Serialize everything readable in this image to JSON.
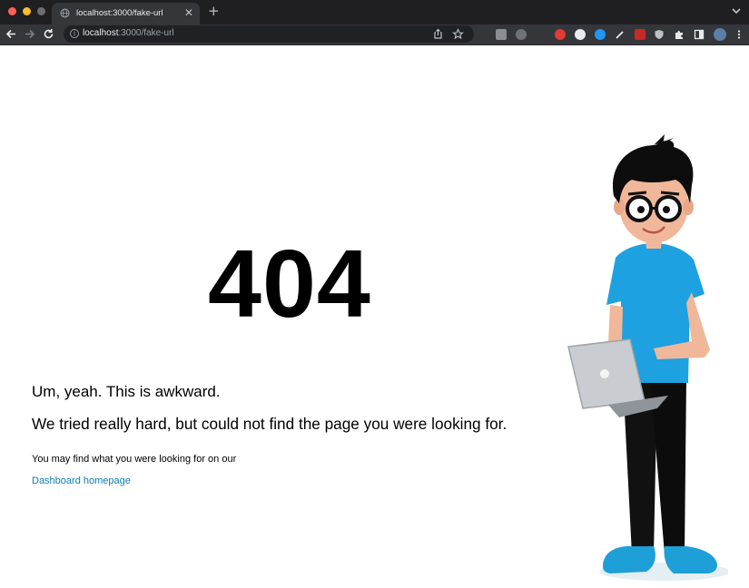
{
  "browser": {
    "tab": {
      "title": "localhost:3000/fake-url",
      "close": "✕"
    },
    "new_tab": "+",
    "url": {
      "host": "localhost",
      "path": ":3000/fake-url"
    }
  },
  "page": {
    "heading": "404",
    "line1": "Um, yeah. This is awkward.",
    "line2": "We tried really hard, but could not find the page you were looking for.",
    "line3": "You may find what you were looking for on our",
    "link": "Dashboard homepage"
  },
  "colors": {
    "link": "#0a7fb5",
    "shirt": "#1da1e0",
    "browser_dark": "#1f1f22"
  }
}
